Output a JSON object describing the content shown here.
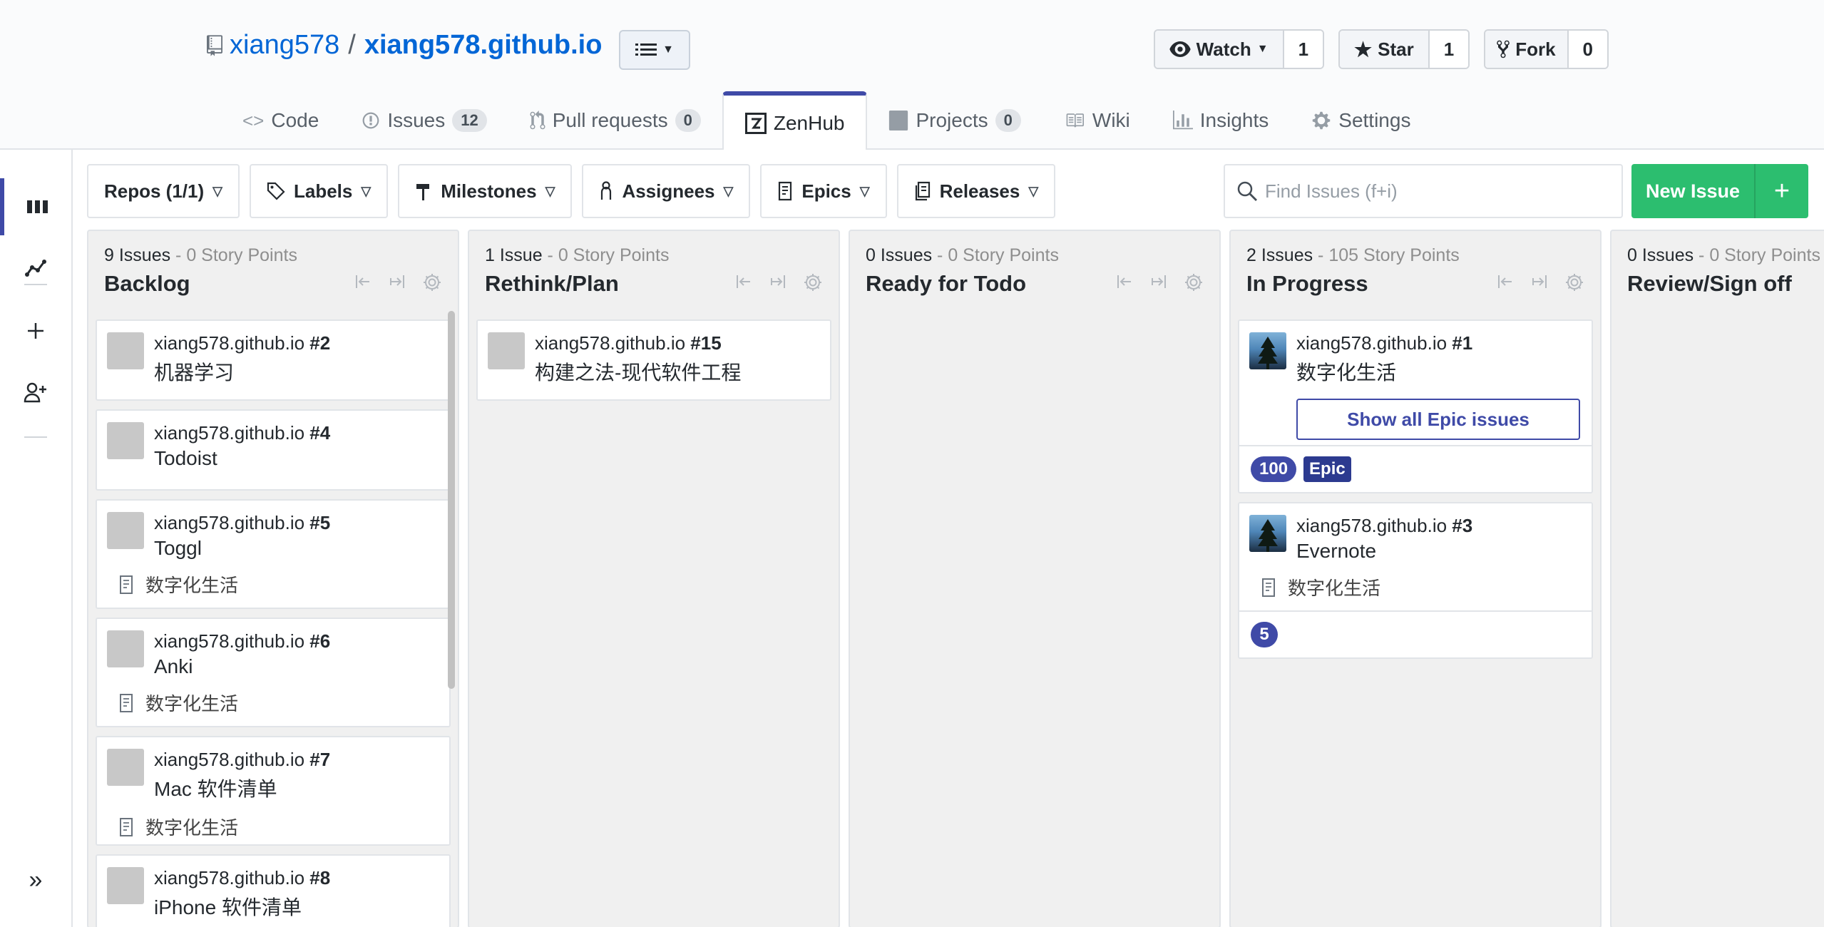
{
  "repo": {
    "owner": "xiang578",
    "separator": "/",
    "name": "xiang578.github.io"
  },
  "header_actions": [
    {
      "label": "Watch",
      "count": "1"
    },
    {
      "label": "Star",
      "count": "1"
    },
    {
      "label": "Fork",
      "count": "0"
    }
  ],
  "tabs": [
    {
      "label": "Code",
      "counter": ""
    },
    {
      "label": "Issues",
      "counter": "12"
    },
    {
      "label": "Pull requests",
      "counter": "0"
    },
    {
      "label": "ZenHub",
      "counter": ""
    },
    {
      "label": "Projects",
      "counter": "0"
    },
    {
      "label": "Wiki",
      "counter": ""
    },
    {
      "label": "Insights",
      "counter": ""
    },
    {
      "label": "Settings",
      "counter": ""
    }
  ],
  "toolbar": {
    "filters": [
      "Repos (1/1)",
      "Labels",
      "Milestones",
      "Assignees",
      "Epics",
      "Releases"
    ],
    "search_placeholder": "Find Issues (f+i)",
    "new_issue_label": "New Issue",
    "new_issue_plus": "+"
  },
  "leftnav": {
    "expand_glyph": "»"
  },
  "pipelines": [
    {
      "count": "9 Issues",
      "points": " - 0 Story Points",
      "name": "Backlog",
      "cards": [
        {
          "repo": "xiang578.github.io ",
          "num": "#2",
          "title": "机器学习",
          "epic": ""
        },
        {
          "repo": "xiang578.github.io ",
          "num": "#4",
          "title": "Todoist",
          "epic": ""
        },
        {
          "repo": "xiang578.github.io ",
          "num": "#5",
          "title": "Toggl",
          "epic": "数字化生活"
        },
        {
          "repo": "xiang578.github.io ",
          "num": "#6",
          "title": "Anki",
          "epic": "数字化生活"
        },
        {
          "repo": "xiang578.github.io ",
          "num": "#7",
          "title": "Mac 软件清单",
          "epic": "数字化生活"
        },
        {
          "repo": "xiang578.github.io ",
          "num": "#8",
          "title": "iPhone 软件清单",
          "epic": ""
        }
      ]
    },
    {
      "count": "1 Issue",
      "points": " - 0 Story Points",
      "name": "Rethink/Plan",
      "cards": [
        {
          "repo": "xiang578.github.io ",
          "num": "#15",
          "title": "构建之法-现代软件工程",
          "epic": ""
        }
      ]
    },
    {
      "count": "0 Issues",
      "points": " - 0 Story Points",
      "name": "Ready for Todo",
      "cards": []
    },
    {
      "count": "2 Issues",
      "points": " - 105 Story Points",
      "name": "In Progress",
      "cards": [
        {
          "repo": "xiang578.github.io ",
          "num": "#1",
          "title": "数字化生活",
          "epic_button": "Show all Epic issues",
          "estimate": "100",
          "tag": "Epic"
        },
        {
          "repo": "xiang578.github.io ",
          "num": "#3",
          "title": "Evernote",
          "epic": "数字化生活",
          "estimate": "5"
        }
      ]
    },
    {
      "count": "0 Issues",
      "points": " - 0 Story Points",
      "name": "Review/Sign off",
      "cards": []
    }
  ],
  "colors": {
    "zenhub_accent": "#3f4aa7",
    "new_issue_green": "#2cbe6f",
    "link_blue": "#0366d6"
  }
}
